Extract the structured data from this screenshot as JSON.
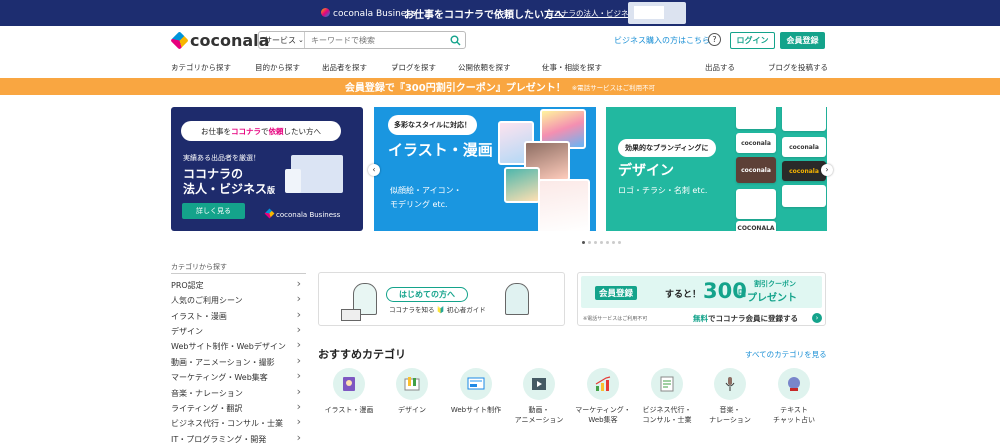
{
  "topbar": {
    "brand": "coconala Business",
    "message": "お仕事をココナラで依頼したい方へ",
    "link": "ココナラの法人・ビジネス版"
  },
  "header": {
    "logo": "coconala",
    "search_category": "サービス",
    "search_placeholder": "キーワードで検索",
    "business_link": "ビジネス購入の方はこちら",
    "help": "?",
    "login": "ログイン",
    "register": "会員登録"
  },
  "nav": {
    "items": [
      "カテゴリから探す",
      "目的から探す",
      "出品者を探す",
      "ブログを探す",
      "公開依頼を探す",
      "仕事・相談を探す",
      "出品する",
      "ブログを投稿する"
    ]
  },
  "promo": {
    "text": "会員登録で『300円割引クーポン』プレゼント！",
    "note": "※電話サービスはご利用不可"
  },
  "banners": {
    "business": {
      "pill_pre": "お仕事を",
      "pill_b1": "ココナラ",
      "pill_mid": "で",
      "pill_b2": "依頼",
      "pill_post": "したい方へ",
      "line1": "実績ある出品者を厳選！",
      "line2": "ココナラの",
      "line3a": "法人・ビジネス",
      "line3b": "版",
      "button": "詳しく見る",
      "brand": "coconala Business"
    },
    "illust": {
      "pill": "多彩なスタイルに対応！",
      "title": "イラスト・漫画",
      "sub1": "似顔絵・アイコン・",
      "sub2": "モデリング etc."
    },
    "design": {
      "pill": "効果的なブランディングに",
      "title": "デザイン",
      "sub": "ロゴ・チラシ・名刺 etc.",
      "cards": [
        "coconala",
        "coconala",
        "coconala",
        "coconala",
        "COCONALA"
      ]
    }
  },
  "sidebar": {
    "heading": "カテゴリから探す",
    "items": [
      "PRO認定",
      "人気のご利用シーン",
      "イラスト・漫画",
      "デザイン",
      "Webサイト制作・Webデザイン",
      "動画・アニメーション・撮影",
      "マーケティング・Web集客",
      "音楽・ナレーション",
      "ライティング・翻訳",
      "ビジネス代行・コンサル・士業",
      "IT・プログラミング・開発"
    ]
  },
  "guide": {
    "title": "はじめての方へ",
    "sub": "ココナラを知る 🔰 初心者ガイド"
  },
  "coupon": {
    "a": "会員登録",
    "b": "すると！",
    "amount": "300",
    "yen": "円",
    "label1": "割引クーポン",
    "label2": "プレゼント",
    "note": "※電話サービスはご利用不可",
    "cta_green": "無料",
    "cta_rest": "でココナラ会員に登録する",
    "arrow": "›"
  },
  "recommend": {
    "heading": "おすすめカテゴリ",
    "all_link": "すべてのカテゴリを見る",
    "items": [
      {
        "l1": "イラスト・漫画",
        "l2": "",
        "icon": "illustration-icon"
      },
      {
        "l1": "デザイン",
        "l2": "",
        "icon": "design-icon"
      },
      {
        "l1": "Webサイト制作",
        "l2": "",
        "icon": "website-icon"
      },
      {
        "l1": "動画・",
        "l2": "アニメーション",
        "icon": "video-icon"
      },
      {
        "l1": "マーケティング・",
        "l2": "Web集客",
        "icon": "marketing-icon"
      },
      {
        "l1": "ビジネス代行・",
        "l2": "コンサル・士業",
        "icon": "business-icon"
      },
      {
        "l1": "音楽・",
        "l2": "ナレーション",
        "icon": "music-icon"
      },
      {
        "l1": "テキスト",
        "l2": "チャット占い",
        "icon": "fortune-icon"
      }
    ]
  }
}
